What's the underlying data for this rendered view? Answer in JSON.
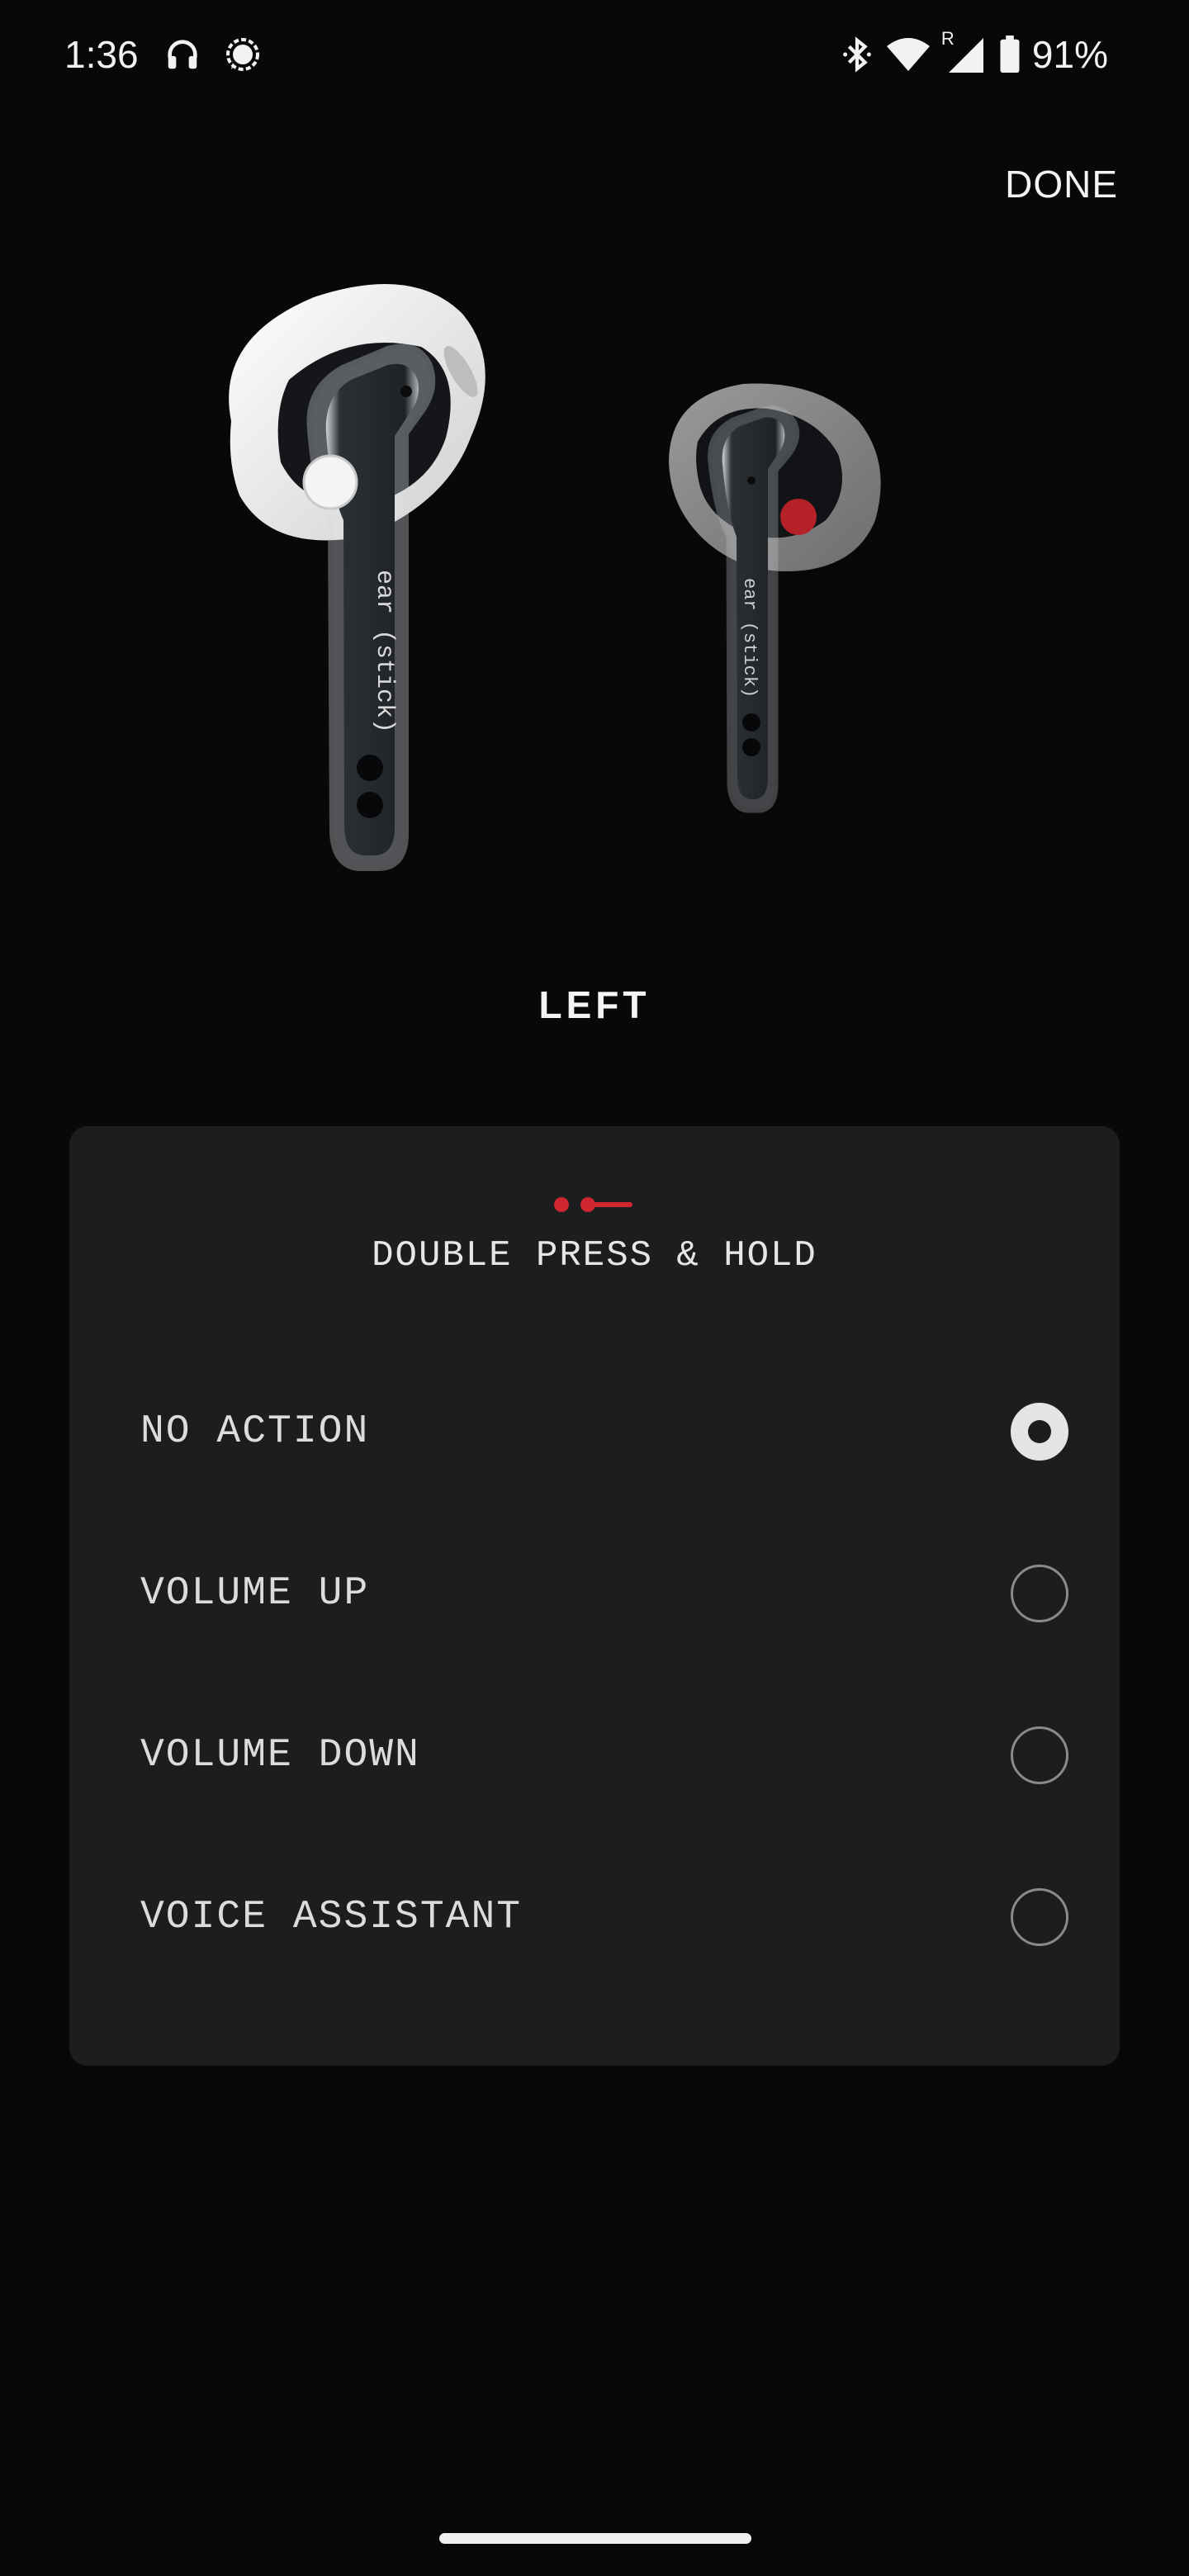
{
  "status_bar": {
    "time": "1:36",
    "battery_percent": "91%",
    "left_icons": [
      "headphones-icon",
      "signal-messenger-icon"
    ],
    "right_icons": [
      "bluetooth-icon",
      "wifi-icon",
      "cell-signal-roaming-icon",
      "battery-icon"
    ],
    "roaming_letter": "R"
  },
  "header": {
    "done_label": "DONE"
  },
  "earbuds": {
    "left_bud_color": "#ffffff",
    "right_bud_color": "#c0202a",
    "stem_text": "ear (stick)"
  },
  "side_label": "LEFT",
  "card": {
    "gesture_icon": "double-press-hold-icon",
    "gesture_title": "DOUBLE PRESS & HOLD",
    "accent_color": "#d0262f",
    "options": [
      {
        "label": "NO ACTION",
        "selected": true
      },
      {
        "label": "VOLUME UP",
        "selected": false
      },
      {
        "label": "VOLUME DOWN",
        "selected": false
      },
      {
        "label": "VOICE ASSISTANT",
        "selected": false
      }
    ]
  }
}
